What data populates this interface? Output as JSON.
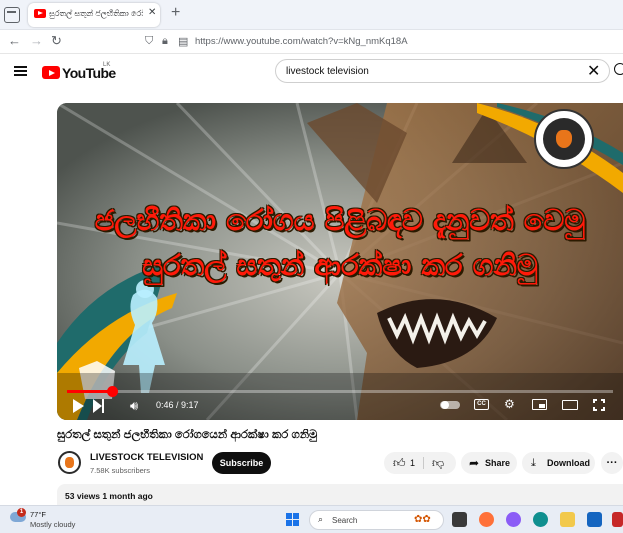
{
  "browser": {
    "tab_title": "සුරතල් සතුන් ජලභීතිකා රෝගයෙන් ආරක්ෂා කර ගනිමු",
    "tab_close": "✕",
    "new_tab": "+",
    "url": "https://www.youtube.com/watch?v=kNg_nmKq18A"
  },
  "youtube": {
    "logo_text": "YouTube",
    "country_code": "LK",
    "search_query": "livestock television",
    "search_clear": "✕"
  },
  "video": {
    "thumbnail_line1": "ජලභීතිකා රෝගය පිළිබඳව දැනුවත් වෙමු",
    "thumbnail_line2": "සුරතල් සතුන් ආරක්ෂා කර ගනිමු",
    "time_display": "0:46 / 9:17",
    "progress_fraction": 0.083,
    "cc_label": "CC",
    "title": "සුරතල් සතුන් ජලභීතිකා රෝගයෙන් ආරක්ෂා කර ගනිමු"
  },
  "channel": {
    "name": "LIVESTOCK TELEVISION",
    "subscribers": "7.58K subscribers",
    "subscribe_label": "Subscribe"
  },
  "actions": {
    "like_count": "1",
    "share_label": "Share",
    "download_label": "Download",
    "more_label": "···"
  },
  "description": {
    "stats": "53 views  1 month ago"
  },
  "taskbar": {
    "weather_badge": "1",
    "temperature": "77°F",
    "condition": "Mostly cloudy",
    "search_placeholder": "Search"
  },
  "colors": {
    "youtube_red": "#ff0000",
    "subscribe_bg": "#0f0f0f",
    "thumbnail_text": "#ff1a0a",
    "thumbnail_accent": "#f2a900",
    "thumbnail_teal": "#1f6b6b"
  }
}
